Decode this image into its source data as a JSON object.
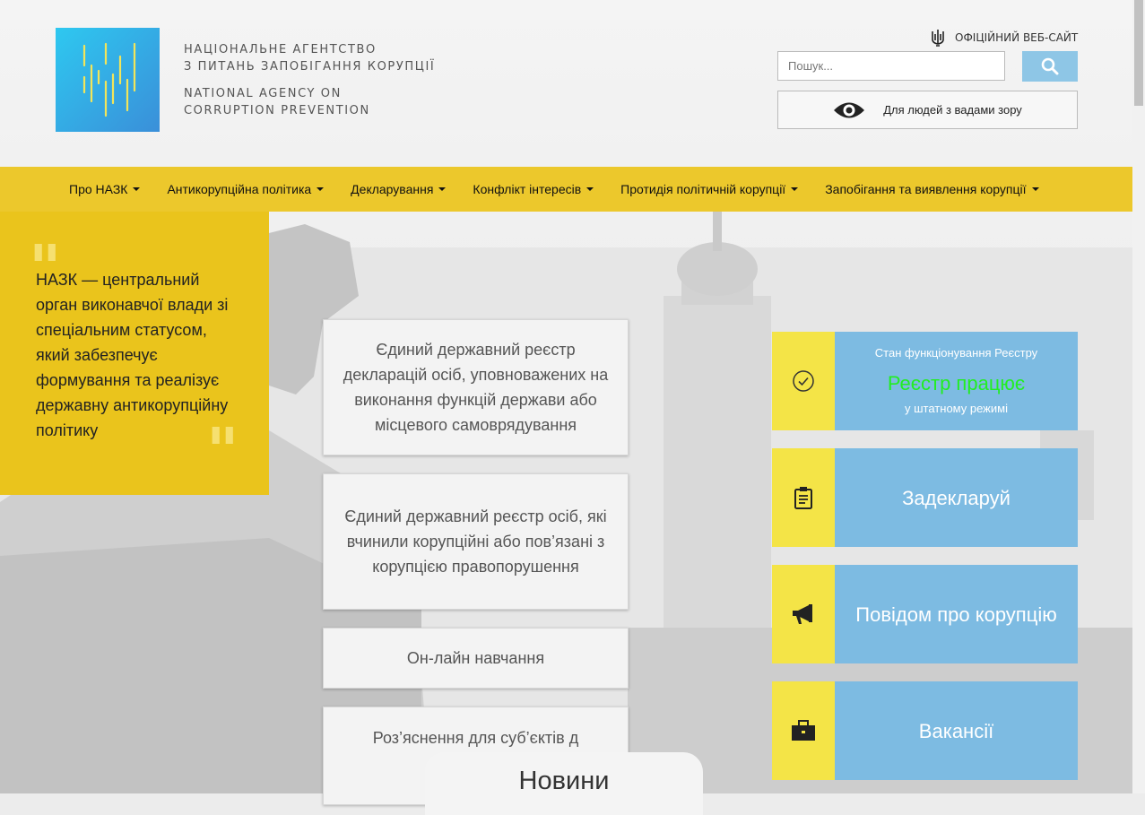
{
  "header": {
    "logo_ua": [
      "НАЦІОНАЛЬНЕ АГЕНТСТВО",
      "З ПИТАНЬ ЗАПОБІГАННЯ КОРУПЦІЇ"
    ],
    "logo_en": [
      "NATIONAL AGENCY ON",
      "CORRUPTION PREVENTION"
    ],
    "official_label": "ОФІЦІЙНИЙ ВЕБ-САЙТ",
    "search_placeholder": "Пошук...",
    "vision_label": "Для людей з вадами зору"
  },
  "nav": [
    {
      "label": "Про НАЗК"
    },
    {
      "label": "Антикорупційна політика"
    },
    {
      "label": "Декларування"
    },
    {
      "label": "Конфлікт інтересів"
    },
    {
      "label": "Протидія політичній корупції"
    },
    {
      "label": "Запобігання та виявлення корупції"
    }
  ],
  "quote": {
    "text": "НАЗК — центральний орган  виконавчої влади зі спеціальним статусом, який забезпечує формування та реалізує державну антикорупційну політику"
  },
  "cards": [
    "Єдиний державний реєстр декларацій осіб, уповноважених на виконання функцій держави або місцевого самоврядування",
    "Єдиний державний реєстр осіб, які вчинили корупційні або пов’язані з корупцією правопорушення",
    "Он-лайн навчання",
    "Роз’яснення для суб’єктів д"
  ],
  "news_label": "Новини",
  "status": {
    "title": "Стан функціонування Реєстру",
    "main": "Реєстр працює",
    "sub": "у штатному режимі"
  },
  "tiles": [
    {
      "label": "Задекларуй",
      "icon": "clipboard-icon"
    },
    {
      "label": "Повідом про корупцію",
      "icon": "megaphone-icon"
    },
    {
      "label": "Вакансії",
      "icon": "briefcase-icon"
    }
  ],
  "colors": {
    "nav_bg": "#ecc82c",
    "quote_bg": "#eac41c",
    "tile_icon_bg": "#f4e447",
    "tile_text_bg": "#7dbbe2",
    "status_green": "#22ee22",
    "logo_blue": "#2ec8f0"
  }
}
